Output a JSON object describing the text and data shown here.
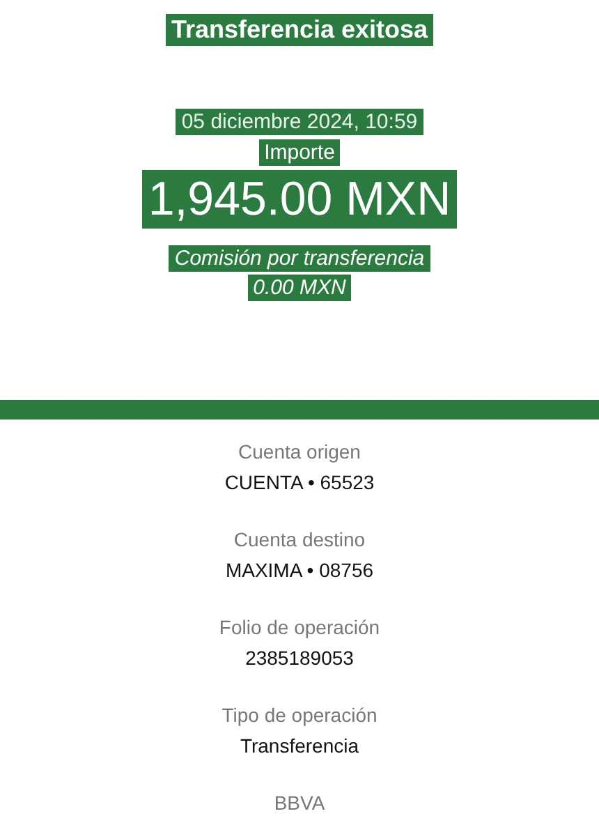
{
  "summary": {
    "title": "Transferencia exitosa",
    "date": "05 diciembre 2024, 10:59",
    "amount_label": "Importe",
    "amount": "1,945.00 MXN",
    "fee_label": "Comisión por transferencia",
    "fee": "0.00 MXN"
  },
  "details": [
    {
      "label": "Cuenta origen",
      "value": "CUENTA • 65523"
    },
    {
      "label": "Cuenta destino",
      "value": "MAXIMA • 08756"
    },
    {
      "label": "Folio de operación",
      "value": "2385189053"
    },
    {
      "label": "Tipo de operación",
      "value": "Transferencia"
    }
  ],
  "footer": "BBVA"
}
